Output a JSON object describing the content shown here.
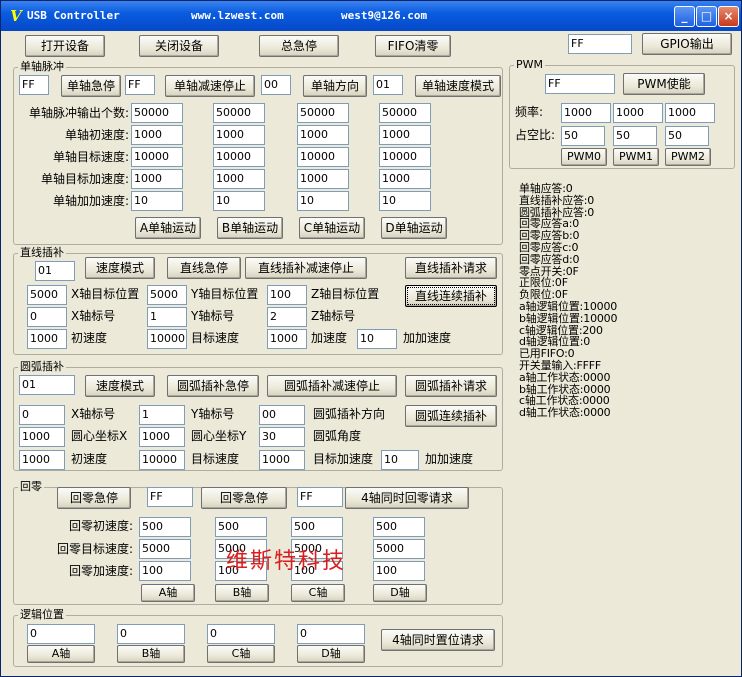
{
  "title_bar": {
    "app": "USB Controller",
    "site": "www.lzwest.com",
    "email": "west9@126.com",
    "icon": "app-icon",
    "min": "_",
    "max": "□",
    "close": "×"
  },
  "top": {
    "open": "打开设备",
    "close": "关闭设备",
    "estop": "总急停",
    "fifo_clear": "FIFO清零",
    "gpio_value": "FF",
    "gpio_out": "GPIO输出"
  },
  "pwm": {
    "title": "PWM",
    "value": "FF",
    "enable": "PWM使能",
    "freq_label": "频率:",
    "freq": [
      "1000",
      "1000",
      "1000"
    ],
    "duty_label": "占空比:",
    "duty": [
      "50",
      "50",
      "50"
    ],
    "buttons": [
      "PWM0",
      "PWM1",
      "PWM2"
    ]
  },
  "single": {
    "title": "单轴脉冲",
    "estop_val": "FF",
    "estop": "单轴急停",
    "dec_val": "FF",
    "dec_stop": "单轴减速停止",
    "dir_val": "00",
    "dir": "单轴方向",
    "speed_val": "01",
    "speed_mode": "单轴速度模式",
    "row_labels": [
      "单轴脉冲输出个数:",
      "单轴初速度:",
      "单轴目标速度:",
      "单轴目标加速度:",
      "单轴加加速度:"
    ],
    "grid": [
      [
        "50000",
        "50000",
        "50000",
        "50000"
      ],
      [
        "1000",
        "1000",
        "1000",
        "1000"
      ],
      [
        "10000",
        "10000",
        "10000",
        "10000"
      ],
      [
        "1000",
        "1000",
        "1000",
        "1000"
      ],
      [
        "10",
        "10",
        "10",
        "10"
      ]
    ],
    "move": [
      "A单轴运动",
      "B单轴运动",
      "C单轴运动",
      "D单轴运动"
    ]
  },
  "linear": {
    "title": "直线插补",
    "mode_val": "01",
    "speed_mode": "速度模式",
    "estop": "直线急停",
    "dec_stop": "直线插补减速停止",
    "request": "直线插补请求",
    "cont": "直线连续插补",
    "x_target": "5000",
    "x_target_lbl": "X轴目标位置",
    "y_target": "5000",
    "y_target_lbl": "Y轴目标位置",
    "z_target": "100",
    "z_target_lbl": "Z轴目标位置",
    "x_axis": "0",
    "x_axis_lbl": "X轴标号",
    "y_axis": "1",
    "y_axis_lbl": "Y轴标号",
    "z_axis": "2",
    "z_axis_lbl": "Z轴标号",
    "init": "1000",
    "init_lbl": "初速度",
    "target": "10000",
    "target_lbl": "目标速度",
    "acc": "1000",
    "acc_lbl": "加速度",
    "jerk": "10",
    "jerk_lbl": "加加速度"
  },
  "arc": {
    "title": "圆弧插补",
    "mode_val": "01",
    "speed_mode": "速度模式",
    "estop": "圆弧插补急停",
    "dec_stop": "圆弧插补减速停止",
    "request": "圆弧插补请求",
    "cont": "圆弧连续插补",
    "x_axis": "0",
    "x_axis_lbl": "X轴标号",
    "y_axis": "1",
    "y_axis_lbl": "Y轴标号",
    "dir": "00",
    "dir_lbl": "圆弧插补方向",
    "cx": "1000",
    "cx_lbl": "圆心坐标X",
    "cy": "1000",
    "cy_lbl": "圆心坐标Y",
    "angle": "30",
    "angle_lbl": "圆弧角度",
    "init": "1000",
    "init_lbl": "初速度",
    "target": "10000",
    "target_lbl": "目标速度",
    "acc": "1000",
    "acc_lbl": "目标加速度",
    "jerk": "10",
    "jerk_lbl": "加加速度"
  },
  "home": {
    "title": "回零",
    "btn1": "回零急停",
    "val1": "FF",
    "btn2": "回零急停",
    "val2": "FF",
    "req4": "4轴同时回零请求",
    "row_labels": [
      "回零初速度:",
      "回零目标速度:",
      "回零加速度:"
    ],
    "grid": [
      [
        "500",
        "500",
        "500",
        "500"
      ],
      [
        "5000",
        "5000",
        "5000",
        "5000"
      ],
      [
        "100",
        "100",
        "100",
        "100"
      ]
    ],
    "axes": [
      "A轴",
      "B轴",
      "C轴",
      "D轴"
    ]
  },
  "logic": {
    "title": "逻辑位置",
    "values": [
      "0",
      "0",
      "0",
      "0"
    ],
    "axes": [
      "A轴",
      "B轴",
      "C轴",
      "D轴"
    ],
    "req": "4轴同时置位请求"
  },
  "status": [
    "单轴应答:0",
    "直线插补应答:0",
    "圆弧插补应答:0",
    "回零应答a:0",
    "回零应答b:0",
    "回零应答c:0",
    "回零应答d:0",
    "零点开关:0F",
    "正限位:0F",
    "负限位:0F",
    "a轴逻辑位置:10000",
    "b轴逻辑位置:10000",
    "c轴逻辑位置:200",
    "d轴逻辑位置:0",
    "已用FIFO:0",
    "开关量输入:FFFF",
    "a轴工作状态:0000",
    "b轴工作状态:0000",
    "c轴工作状态:0000",
    "d轴工作状态:0000"
  ],
  "watermark": "维斯特科技"
}
